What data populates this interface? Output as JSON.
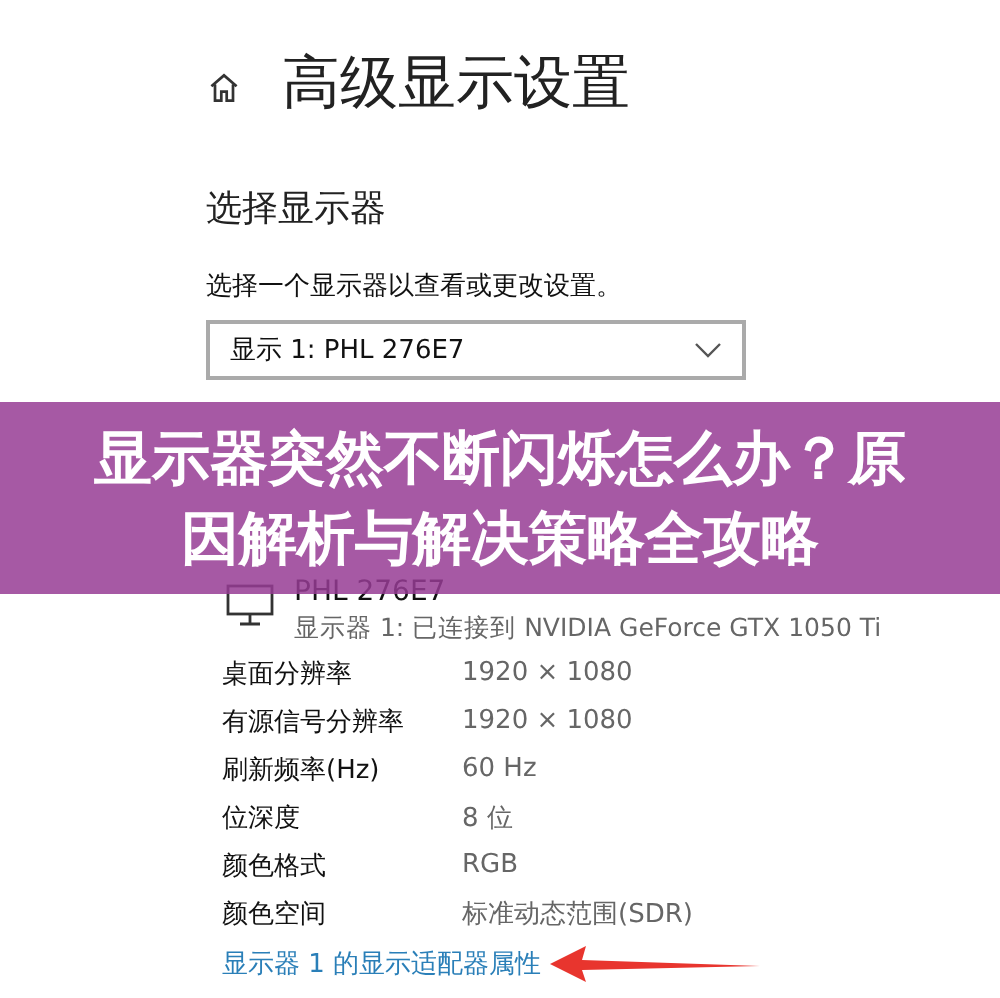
{
  "page": {
    "title": "高级显示设置"
  },
  "section": {
    "heading": "选择显示器",
    "description": "选择一个显示器以查看或更改设置。"
  },
  "display_select": {
    "value": "显示 1: PHL 276E7"
  },
  "monitor": {
    "name": "PHL 276E7",
    "connection": "显示器 1: 已连接到 NVIDIA GeForce GTX 1050 Ti"
  },
  "info_rows": [
    {
      "label": "桌面分辨率",
      "value": "1920 × 1080"
    },
    {
      "label": "有源信号分辨率",
      "value": "1920 × 1080"
    },
    {
      "label": "刷新频率(Hz)",
      "value": "60 Hz"
    },
    {
      "label": "位深度",
      "value": "8 位"
    },
    {
      "label": "颜色格式",
      "value": "RGB"
    },
    {
      "label": "颜色空间",
      "value": "标准动态范围(SDR)"
    }
  ],
  "adapter_link": "显示器 1 的显示适配器属性",
  "banner": {
    "title": "显示器突然不断闪烁怎么办？原因解析与解决策略全攻略"
  }
}
